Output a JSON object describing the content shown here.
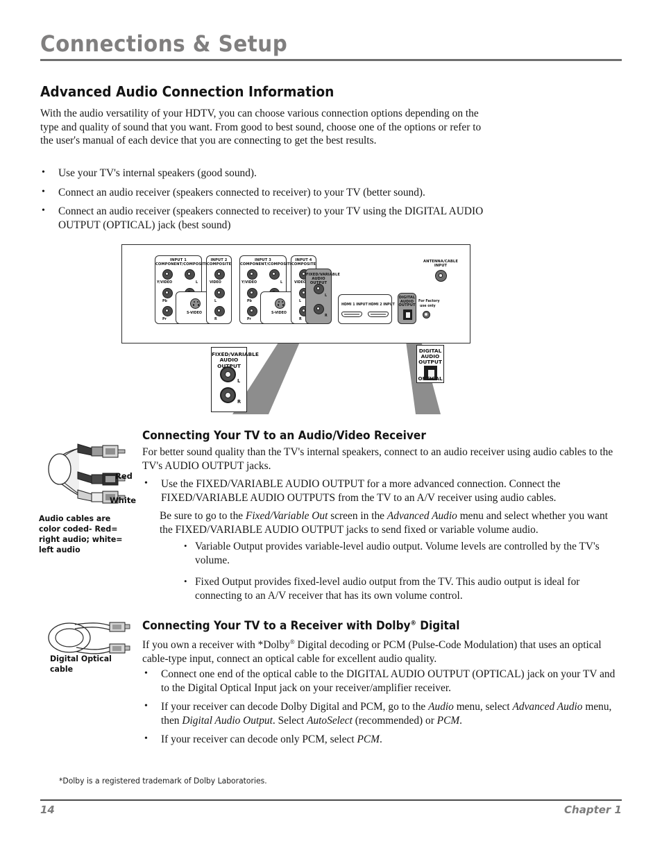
{
  "running_head": {
    "title": "Connections & Setup"
  },
  "sections": {
    "advanced_audio": {
      "heading": "Advanced Audio Connection Information",
      "intro": "With the audio versatility of your HDTV, you can choose various connection options depending on the type and quality of sound that you want. From good to best sound, choose one of the options or refer to the user's manual of each device that you are connecting to get the best results.",
      "bullets": [
        "Use your TV's internal speakers (good sound).",
        "Connect an audio receiver (speakers connected to receiver) to your TV (better sound).",
        "Connect an audio receiver (speakers connected to receiver) to your TV using the DIGITAL AUDIO OUTPUT (OPTICAL) jack (best sound)"
      ]
    },
    "av_receiver": {
      "heading": "Connecting Your TV to an Audio/Video Receiver",
      "intro": "For better sound quality than the TV's internal speakers, connect to an audio receiver using audio cables to the TV's AUDIO OUTPUT jacks.",
      "bullet": "Use the FIXED/VARIABLE AUDIO OUTPUT for a more advanced connection. Connect the FIXED/VARIABLE AUDIO OUTPUTS from the TV to an A/V receiver using audio cables.",
      "note_pre": "Be sure to go to the ",
      "note_it1": "Fixed/Variable Out",
      "note_mid": " screen in the ",
      "note_it2": "Advanced Audio",
      "note_post": " menu and select whether you want the FIXED/VARIABLE AUDIO OUTPUT jacks to send fixed or variable volume audio.",
      "subbullets": [
        "Variable Output provides variable-level audio output. Volume levels are controlled by the TV's volume.",
        "Fixed Output provides fixed-level audio output from the TV. This audio output is ideal for connecting to an A/V receiver that has its own volume control."
      ],
      "caption": "Audio cables are color coded- Red= right audio; white= left audio",
      "cable_tag_red": "Red",
      "cable_tag_white": "White"
    },
    "dolby": {
      "heading_pre": "Connecting Your TV to a Receiver with Dolby",
      "heading_reg": "®",
      "heading_post": " Digital",
      "intro_pre": "If you own a receiver with *Dolby",
      "intro_reg": "®",
      "intro_post": " Digital decoding or PCM (Pulse-Code Modulation) that uses an optical cable-type input, connect an optical cable for excellent audio quality.",
      "bullet1": "Connect one end of the optical cable to the DIGITAL AUDIO OUTPUT (OPTICAL) jack on your TV and to the Digital Optical Input jack on your receiver/amplifier receiver.",
      "bullet2_p1": "If your receiver can decode Dolby Digital and PCM, go to the ",
      "bullet2_i1": "Audio",
      "bullet2_p2": " menu, select ",
      "bullet2_i2": "Advanced Audio",
      "bullet2_p3": " menu, then ",
      "bullet2_i3": "Digital Audio Output",
      "bullet2_p4": ". Select ",
      "bullet2_i4": "AutoSelect",
      "bullet2_p5": " (recommended) or ",
      "bullet2_i5": "PCM",
      "bullet2_p6": ".",
      "bullet3_p1": "If your receiver can decode only PCM, select ",
      "bullet3_i1": "PCM",
      "bullet3_p2": ".",
      "caption": "Digital Optical cable"
    }
  },
  "panel_diagram": {
    "groups": [
      {
        "title": "INPUT 1\nCOMPONENT/COMPOSITE"
      },
      {
        "title": "INPUT 2\nCOMPOSITE"
      },
      {
        "title": "INPUT 3\nCOMPONENT/COMPOSITE"
      },
      {
        "title": "INPUT 4\nCOMPOSITE"
      }
    ],
    "labels": {
      "input1_title_l1": "INPUT 1",
      "input1_title_l2": "COMPONENT/COMPOSITE",
      "input2_title_l1": "INPUT 2",
      "input2_title_l2": "COMPOSITE",
      "input3_title_l1": "INPUT 3",
      "input3_title_l2": "COMPONENT/COMPOSITE",
      "input4_title_l1": "INPUT 4",
      "input4_title_l2": "COMPOSITE",
      "y_video": "Y/VIDEO",
      "video": "VIDEO",
      "pb": "Pb",
      "pr": "Pr",
      "l": "L",
      "r": "R",
      "s_video": "S-VIDEO",
      "fixed_variable_l1": "FIXED/VARIABLE",
      "fixed_variable_l2": "AUDIO OUTPUT",
      "hdmi1": "HDMI 1 INPUT",
      "hdmi2": "HDMI 2 INPUT",
      "digital_audio_l1": "DIGITAL",
      "digital_audio_l2": "AUDIO",
      "digital_audio_l3": "OUTPUT",
      "factory_l1": "For Factory",
      "factory_l2": "use only",
      "antenna_l1": "ANTENNA/CABLE",
      "antenna_l2": "INPUT"
    },
    "callout_fixed": {
      "title_l1": "FIXED/VARIABLE",
      "title_l2": "AUDIO OUTPUT",
      "label_l": "L",
      "label_r": "R"
    },
    "callout_optical": {
      "title_l1": "DIGITAL",
      "title_l2": "AUDIO",
      "title_l3": "OUTPUT",
      "label_optical": "OPTICAL"
    }
  },
  "footnote": "*Dolby is a registered trademark of Dolby Laboratories.",
  "footer": {
    "page_number": "14",
    "chapter": "Chapter 1"
  }
}
